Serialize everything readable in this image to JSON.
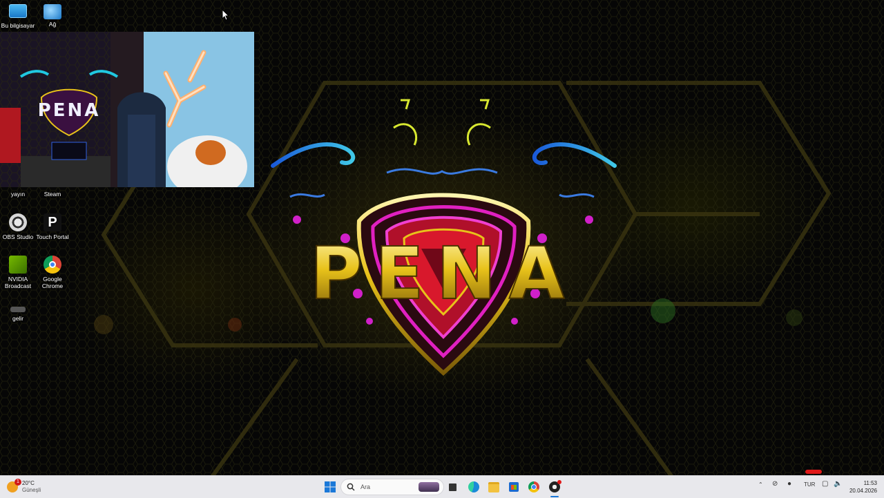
{
  "desktop": {
    "icons": [
      {
        "label": "Bu bilgisayar",
        "icon": "this-pc-icon"
      },
      {
        "label": "Ağ",
        "icon": "network-icon"
      },
      {
        "label": "yayın",
        "icon": "folder-icon"
      },
      {
        "label": "Steam",
        "icon": "steam-icon"
      },
      {
        "label": "OBS Studio",
        "icon": "obs-icon"
      },
      {
        "label": "Touch Portal",
        "icon": "touch-portal-icon"
      },
      {
        "label": "NVIDIA Broadcast",
        "icon": "nvidia-icon"
      },
      {
        "label": "Google Chrome",
        "icon": "chrome-icon"
      },
      {
        "label": "gelir",
        "icon": "file-icon"
      }
    ],
    "wallpaper_logo_text": "PENA"
  },
  "webcam_overlay": {
    "logo_text": "PENA"
  },
  "taskbar": {
    "weather": {
      "temp": "20°C",
      "condition": "Güneşli",
      "badge": "1"
    },
    "search_placeholder": "Ara",
    "language": "TUR",
    "time": "11:53",
    "date": "20.04.2026",
    "pinned": [
      "start-icon",
      "search-icon",
      "file-explorer-icon",
      "task-view-icon",
      "edge-icon",
      "folder-icon",
      "store-icon",
      "chrome-icon",
      "obs-icon"
    ]
  },
  "colors": {
    "taskbar_bg": "#e8e8ec",
    "logo_gold": "#e8c21a",
    "logo_magenta": "#e020c0",
    "logo_red": "#c0102a",
    "accent_blue": "#2a8ad8"
  }
}
